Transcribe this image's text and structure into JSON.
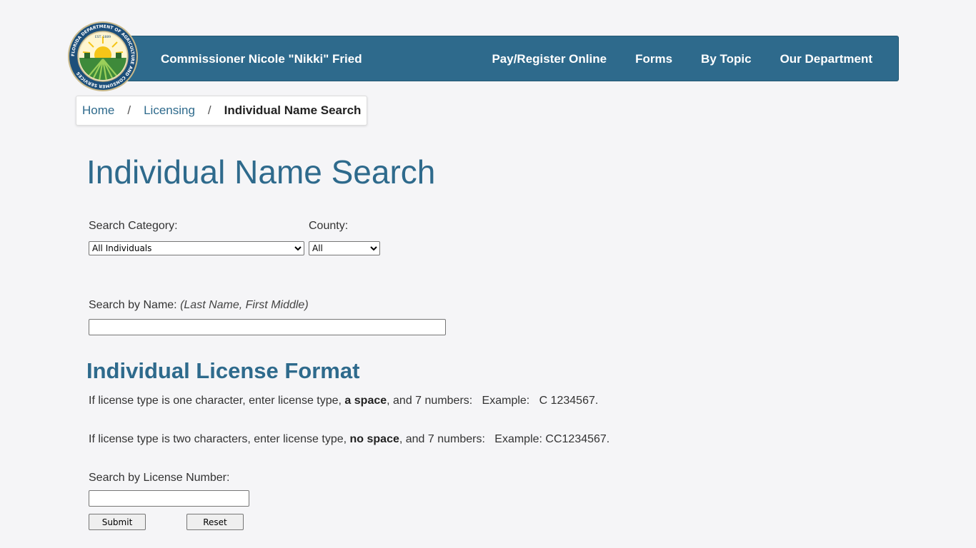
{
  "header": {
    "title": "Commissioner Nicole \"Nikki\" Fried",
    "nav": [
      "Pay/Register Online",
      "Forms",
      "By Topic",
      "Our Department"
    ],
    "colors": {
      "bar": "#2e6a8c",
      "text": "#ffffff"
    }
  },
  "logo": {
    "icon": "fdacs-seal-icon",
    "ring_text": "FLORIDA DEPARTMENT OF AGRICULTURE AND CONSUMER SERVICES",
    "est": "EST. 1889"
  },
  "breadcrumb": {
    "home": "Home",
    "licensing": "Licensing",
    "current": "Individual Name Search",
    "separator": "/"
  },
  "page": {
    "title": "Individual Name Search"
  },
  "search": {
    "category_label": "Search Category:",
    "category_value": "All Individuals",
    "county_label": "County:",
    "county_value": "All",
    "name_label": "Search by Name:",
    "name_hint": "(Last Name, First Middle)",
    "name_value": ""
  },
  "license_format": {
    "title": "Individual License Format",
    "line1_pre": "If license type is one character, enter license type, ",
    "line1_bold": "a space",
    "line1_post": ", and 7 numbers:   Example:   C 1234567.",
    "line2_pre": "If license type is two characters, enter license type, ",
    "line2_bold": "no space",
    "line2_post": ", and 7 numbers:   Example: CC1234567.",
    "license_label": "Search by License Number:",
    "license_value": ""
  },
  "buttons": {
    "submit": "Submit",
    "reset": "Reset"
  }
}
